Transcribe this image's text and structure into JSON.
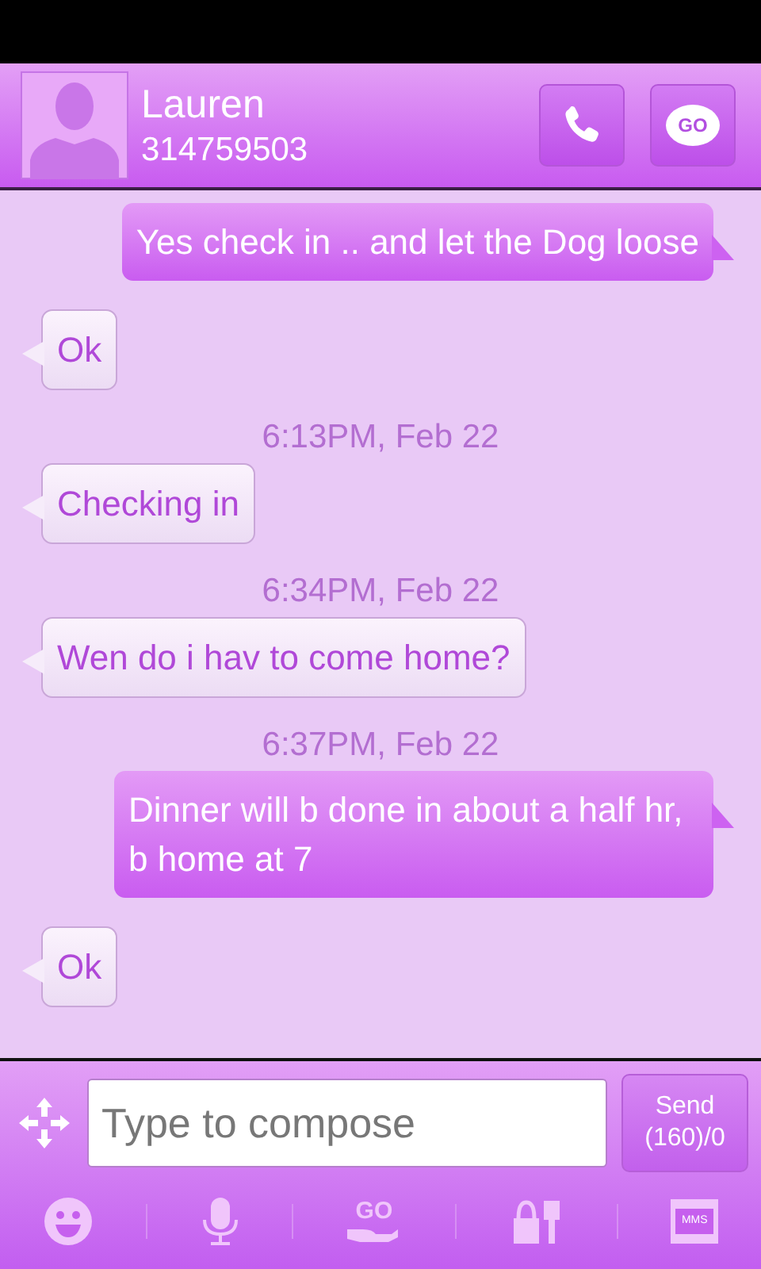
{
  "contact": {
    "name": "Lauren",
    "number": "314759503"
  },
  "header_buttons": {
    "go_label": "GO"
  },
  "messages": [
    {
      "kind": "outgoing",
      "text": "Yes check in .. and let the Dog loose"
    },
    {
      "kind": "incoming",
      "text": "Ok"
    },
    {
      "kind": "timestamp",
      "text": "6:13PM, Feb 22"
    },
    {
      "kind": "incoming",
      "text": "Checking in"
    },
    {
      "kind": "timestamp",
      "text": "6:34PM, Feb 22"
    },
    {
      "kind": "incoming",
      "text": "Wen do i hav to come home?"
    },
    {
      "kind": "timestamp",
      "text": "6:37PM, Feb 22"
    },
    {
      "kind": "outgoing",
      "text": "Dinner will b done in about a half hr, b home at 7"
    },
    {
      "kind": "incoming",
      "text": "Ok"
    }
  ],
  "compose": {
    "placeholder": "Type to compose",
    "send_label": "Send",
    "counter": "(160)/0"
  },
  "toolbar": {
    "go_label": "GO",
    "mms_label": "MMS"
  }
}
